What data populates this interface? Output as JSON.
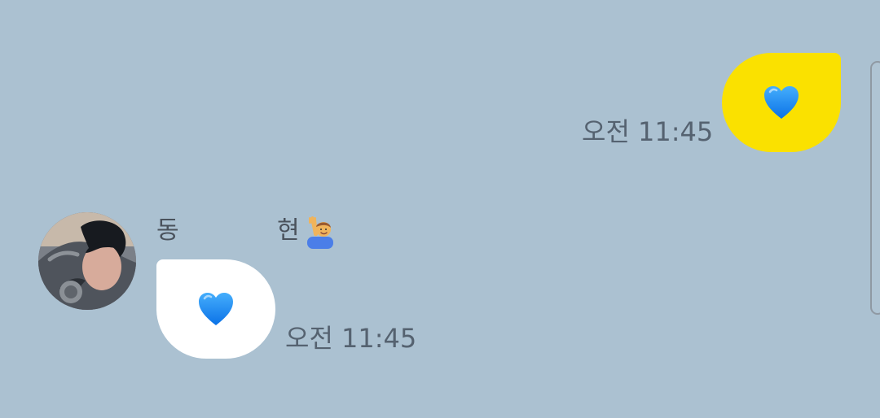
{
  "app": {
    "title": ""
  },
  "messages": [
    {
      "direction": "outgoing",
      "content": "💙",
      "timestamp": "오전 11:45",
      "bubble_color": "#FAE100"
    },
    {
      "direction": "incoming",
      "sender": {
        "name_part_1": "동",
        "name_part_2": "현",
        "emoji": "🙋‍♂️",
        "avatar": "profile-photo"
      },
      "content": "💙",
      "timestamp": "오전 11:45",
      "bubble_color": "#FFFFFF"
    }
  ],
  "theme": {
    "background": "#ABC1D1",
    "heart_color": "#1E90FF"
  }
}
